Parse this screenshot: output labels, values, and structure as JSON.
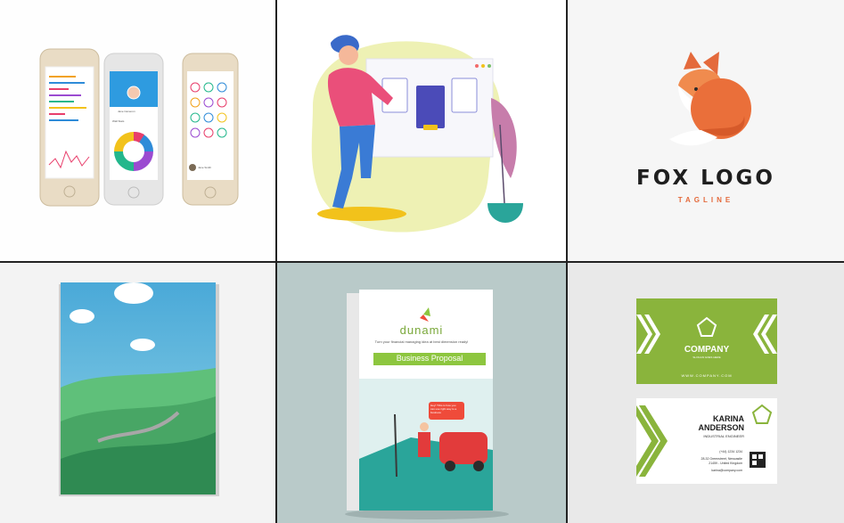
{
  "gallery": {
    "tiles": [
      {
        "subject": "mobile-app-mockup"
      },
      {
        "subject": "web-illustration"
      },
      {
        "subject": "fox-logo"
      },
      {
        "subject": "book-cover"
      },
      {
        "subject": "business-proposal-brochure"
      },
      {
        "subject": "business-card"
      }
    ]
  },
  "fox_logo": {
    "title": "FOX LOGO",
    "tagline": "TAGLINE",
    "accent_color": "#e46a3c"
  },
  "brochure": {
    "brand": "dunami",
    "slogan": "Turn your financial managing idea at best dimension ready!",
    "title": "Business Proposal",
    "bubble": "Hey! Tthis is how you can use right way to a business",
    "accent_color": "#8dc63f"
  },
  "business_card": {
    "company": "COMPANY",
    "slogan": "SLOGAN  GOES  HERE",
    "website": "WWW.COMPANY.COM",
    "name_line1": "KARINA",
    "name_line2": "ANDERSON",
    "role": "INDUSTRIAL ENGINEER",
    "phone": "(+44) 1234 1234",
    "address_line1": "28-32 Greenstreet, Newcastle",
    "address_line2": "21459 - United Kingdom",
    "email": "karina@company.com",
    "accent_color": "#8ab43c"
  },
  "phone_mockup": {
    "profile_name": "Jane Cameron",
    "stat_label": "Wall Stats",
    "footer_name": "Jane Smith"
  }
}
